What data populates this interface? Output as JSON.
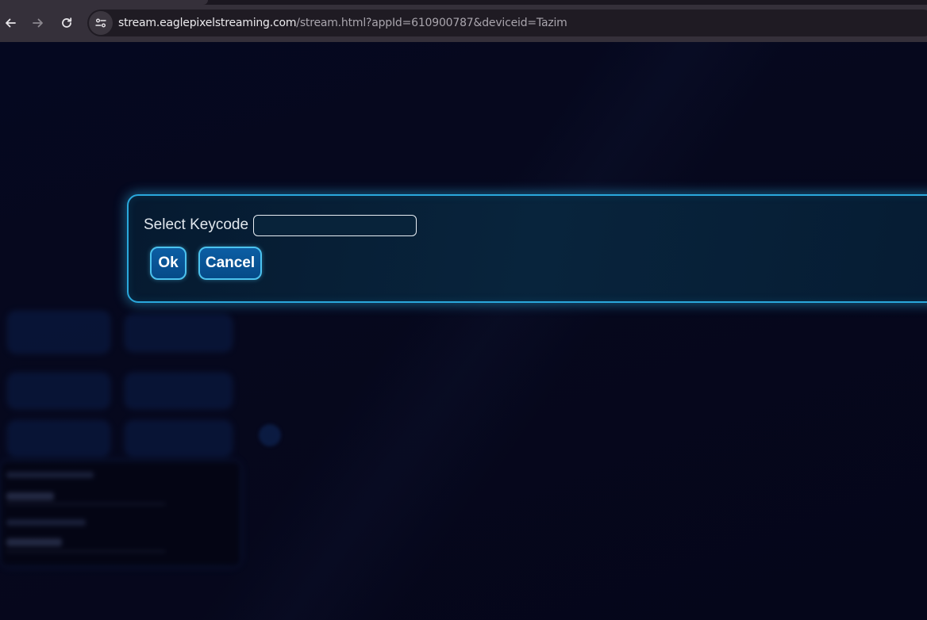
{
  "browser": {
    "back_icon": "arrow-left-icon",
    "forward_icon": "arrow-right-icon",
    "reload_icon": "reload-icon",
    "site_info_icon": "tune-icon",
    "url_host": "stream.eaglepixelstreaming.com",
    "url_path": "/stream.html?appId=610900787&deviceid=Tazim"
  },
  "dialog": {
    "label": "Select Keycode",
    "keycode_value": "",
    "ok_label": "Ok",
    "cancel_label": "Cancel",
    "accent_color": "#2aa8dc",
    "button_color": "#0c5ea4"
  },
  "background": {
    "color": "#04061a"
  }
}
